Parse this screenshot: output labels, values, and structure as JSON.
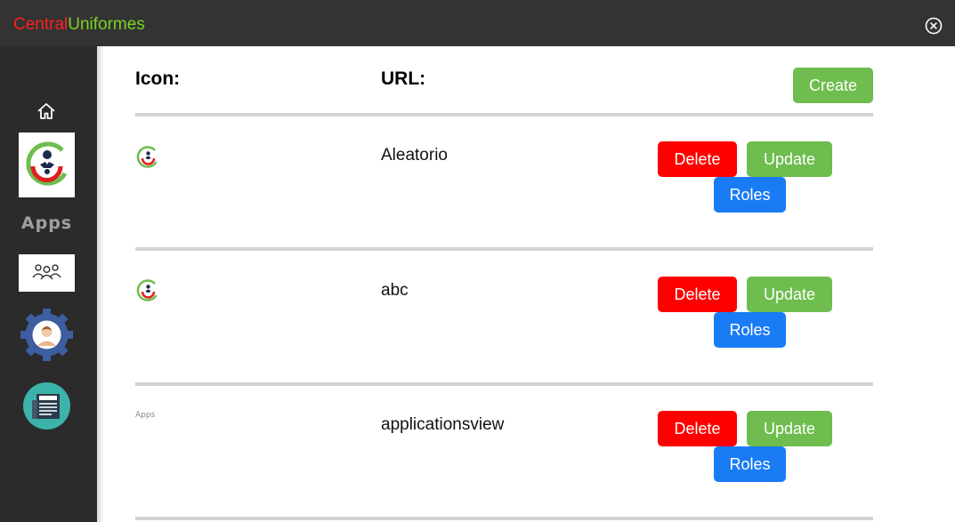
{
  "window": {
    "brand_part1": "Central",
    "brand_part2": "Uniformes",
    "brand_color1": "#ff1f1f",
    "brand_color2": "#7bd321",
    "close_icon": "close-circle-icon"
  },
  "sidebar": {
    "items": [
      {
        "name": "home",
        "icon": "home-icon"
      },
      {
        "name": "logo",
        "icon": "central-uniformes-logo"
      },
      {
        "name": "apps",
        "label": "Apps"
      },
      {
        "name": "users",
        "icon": "users-group-icon"
      },
      {
        "name": "profile",
        "icon": "user-gear-icon"
      },
      {
        "name": "news",
        "icon": "news-icon"
      }
    ]
  },
  "main": {
    "header_icon": "Icon:",
    "header_url": "URL:",
    "create_label": "Create",
    "rows": [
      {
        "icon": "central-uniformes-logo",
        "url": "Aleatorio",
        "delete": "Delete",
        "update": "Update",
        "roles": "Roles"
      },
      {
        "icon": "central-uniformes-logo",
        "url": "abc",
        "delete": "Delete",
        "update": "Update",
        "roles": "Roles"
      },
      {
        "icon_text": "Apps",
        "url": "applicationsview",
        "delete": "Delete",
        "update": "Update",
        "roles": "Roles"
      }
    ]
  },
  "colors": {
    "create": "#6ebd4e",
    "delete": "#ff0000",
    "update": "#6ebd4e",
    "roles": "#1a7cf5",
    "titlebar": "#333333",
    "sidebar": "#2b2b2b"
  }
}
